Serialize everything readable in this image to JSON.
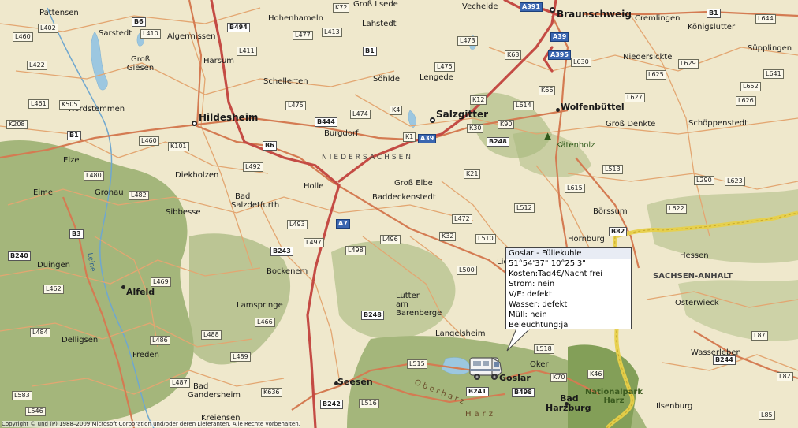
{
  "places": [
    {
      "name": "Pattensen",
      "kind": "town"
    },
    {
      "name": "Sarstedt",
      "kind": "town"
    },
    {
      "name": "Algermissen",
      "kind": "town"
    },
    {
      "name": "Hohenhameln",
      "kind": "town"
    },
    {
      "name": "Groß Ilsede",
      "kind": "town"
    },
    {
      "name": "Lahstedt",
      "kind": "town"
    },
    {
      "name": "Vechelde",
      "kind": "town"
    },
    {
      "name": "Braunschweig",
      "kind": "bigcity"
    },
    {
      "name": "Cremlingen",
      "kind": "town"
    },
    {
      "name": "Königslutter",
      "kind": "town"
    },
    {
      "name": "Süpplingen",
      "kind": "town"
    },
    {
      "name": "Harsum",
      "kind": "town"
    },
    {
      "name": "Groß Giesen",
      "kind": "town"
    },
    {
      "name": "Schellerten",
      "kind": "town"
    },
    {
      "name": "Söhlde",
      "kind": "town"
    },
    {
      "name": "Lengede",
      "kind": "town"
    },
    {
      "name": "Niedersickte",
      "kind": "town"
    },
    {
      "name": "Nordstemmen",
      "kind": "town"
    },
    {
      "name": "Hildesheim",
      "kind": "bigcity"
    },
    {
      "name": "Salzgitter",
      "kind": "bigcity"
    },
    {
      "name": "Wolfenbüttel",
      "kind": "city"
    },
    {
      "name": "Groß Denkte",
      "kind": "town"
    },
    {
      "name": "Schöppenstedt",
      "kind": "town"
    },
    {
      "name": "Burgdorf",
      "kind": "town"
    },
    {
      "name": "Kätenholz",
      "kind": "forest"
    },
    {
      "name": "Elze",
      "kind": "town"
    },
    {
      "name": "Diekholzen",
      "kind": "town"
    },
    {
      "name": "Eime",
      "kind": "town"
    },
    {
      "name": "Gronau",
      "kind": "town"
    },
    {
      "name": "Holle",
      "kind": "town"
    },
    {
      "name": "Groß Elbe",
      "kind": "town"
    },
    {
      "name": "Baddeckenstedt",
      "kind": "town"
    },
    {
      "name": "Bad",
      "kind": "town"
    },
    {
      "name": "Salzdetfurth",
      "kind": "town"
    },
    {
      "name": "Sibbesse",
      "kind": "town"
    },
    {
      "name": "Börssum",
      "kind": "town"
    },
    {
      "name": "Hornburg",
      "kind": "town"
    },
    {
      "name": "Hessen",
      "kind": "town"
    },
    {
      "name": "Duingen",
      "kind": "town"
    },
    {
      "name": "Alfeld",
      "kind": "city"
    },
    {
      "name": "Bockenem",
      "kind": "town"
    },
    {
      "name": "Lutter",
      "kind": "town"
    },
    {
      "name": "am",
      "kind": "town"
    },
    {
      "name": "Barenberge",
      "kind": "town"
    },
    {
      "name": "Lamspringe",
      "kind": "town"
    },
    {
      "name": "Osterwieck",
      "kind": "town"
    },
    {
      "name": "Langelsheim",
      "kind": "town"
    },
    {
      "name": "Delligsen",
      "kind": "town"
    },
    {
      "name": "Freden",
      "kind": "town"
    },
    {
      "name": "Oker",
      "kind": "town"
    },
    {
      "name": "Wasserleben",
      "kind": "town"
    },
    {
      "name": "Goslar",
      "kind": "city"
    },
    {
      "name": "Seesen",
      "kind": "city"
    },
    {
      "name": "Bad",
      "kind": "city"
    },
    {
      "name": "Harzburg",
      "kind": "city"
    },
    {
      "name": "Ilsenburg",
      "kind": "town"
    },
    {
      "name": "Bad",
      "kind": "town"
    },
    {
      "name": "Gandersheim",
      "kind": "town"
    },
    {
      "name": "Kreiensen",
      "kind": "town"
    },
    {
      "name": "Lie",
      "kind": "town"
    }
  ],
  "regions": {
    "niedersachsen": "NIEDERSACHSEN",
    "sachsen_anhalt": "SACHSEN-ANHALT",
    "oberharz": "Oberharz",
    "harz": "Harz",
    "leine": "Leine",
    "nationalpark": [
      "Nationalpark",
      "Harz"
    ]
  },
  "roads": {
    "autobahn": [
      "A391",
      "A39",
      "A395",
      "A39",
      "A7"
    ],
    "bund": [
      "B6",
      "B494",
      "B1",
      "B1",
      "B6",
      "B444",
      "B248",
      "B1",
      "B3",
      "B240",
      "B243",
      "B248",
      "B82",
      "B241",
      "B498",
      "B244",
      "B242"
    ],
    "land": [
      "K72",
      "L460",
      "L402",
      "L410",
      "L477",
      "L413",
      "L411",
      "L473",
      "K63",
      "L644",
      "L422",
      "L475",
      "L630",
      "L629",
      "L641",
      "L461",
      "K505",
      "L475",
      "L474",
      "K4",
      "K12",
      "L614",
      "K66",
      "L625",
      "L652",
      "L627",
      "L626",
      "K208",
      "L460",
      "K101",
      "K1",
      "K30",
      "K90",
      "L482",
      "L492",
      "K21",
      "L513",
      "L480",
      "L615",
      "L290",
      "L623",
      "L493",
      "L472",
      "L512",
      "L622",
      "L497",
      "K32",
      "L510",
      "L498",
      "L496",
      "L500",
      "L469",
      "L462",
      "L466",
      "L484",
      "L488",
      "L486",
      "L489",
      "L518",
      "L87",
      "L487",
      "K636",
      "L515",
      "K46",
      "K70",
      "L583",
      "L546",
      "L516",
      "L85",
      "L82"
    ]
  },
  "popup": {
    "title": "Goslar - Füllekuhle",
    "lines": [
      "51°54'37\" 10°25'3\"",
      "Kosten:Tag4€/Nacht frei",
      "Strom: nein",
      "V/E: defekt",
      "Wasser: defekt",
      "Müll: nein",
      "Beleuchtung:ja"
    ]
  },
  "copyright": "Copyright © und (P) 1988–2009 Microsoft Corporation und/oder deren Lieferanten. Alle Rechte vorbehalten.",
  "colors": {
    "land": "#efe8cc",
    "forest": "#8fa865",
    "water": "#9cc7e0",
    "autobahn": "#c44b44",
    "major_road": "#d47b52",
    "minor_road": "#e3a671",
    "border": "#e7d04a"
  }
}
